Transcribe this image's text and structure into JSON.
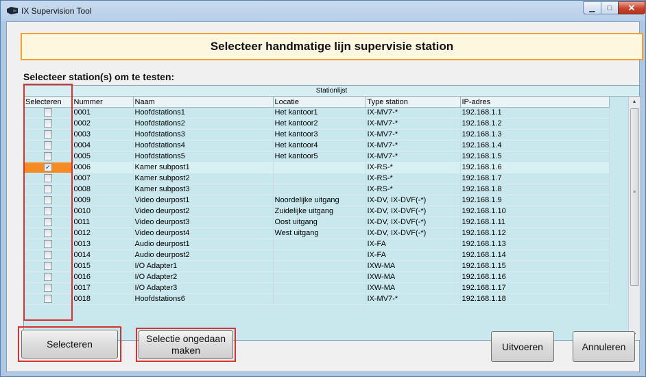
{
  "window": {
    "title": "IX Supervision Tool",
    "icon": "ix-app-icon",
    "controls": [
      "minimize",
      "maximize",
      "close"
    ]
  },
  "header": {
    "title": "Selecteer handmatige lijn supervisie station"
  },
  "instructions": {
    "label": "Selecteer station(s) om te testen:"
  },
  "grid": {
    "caption": "Stationlijst",
    "columns": [
      "Selecteren",
      "Nummer",
      "Naam",
      "Locatie",
      "Type station",
      "IP-adres"
    ],
    "rows": [
      {
        "selected": false,
        "number": "0001",
        "name": "Hoofdstations1",
        "location": "Het kantoor1",
        "type": "IX-MV7-*",
        "ip": "192.168.1.1"
      },
      {
        "selected": false,
        "number": "0002",
        "name": "Hoofdstations2",
        "location": "Het kantoor2",
        "type": "IX-MV7-*",
        "ip": "192.168.1.2"
      },
      {
        "selected": false,
        "number": "0003",
        "name": "Hoofdstations3",
        "location": "Het kantoor3",
        "type": "IX-MV7-*",
        "ip": "192.168.1.3"
      },
      {
        "selected": false,
        "number": "0004",
        "name": "Hoofdstations4",
        "location": "Het kantoor4",
        "type": "IX-MV7-*",
        "ip": "192.168.1.4"
      },
      {
        "selected": false,
        "number": "0005",
        "name": "Hoofdstations5",
        "location": "Het kantoor5",
        "type": "IX-MV7-*",
        "ip": "192.168.1.5"
      },
      {
        "selected": true,
        "number": "0006",
        "name": "Kamer subpost1",
        "location": "",
        "type": "IX-RS-*",
        "ip": "192.168.1.6"
      },
      {
        "selected": false,
        "number": "0007",
        "name": "Kamer subpost2",
        "location": "",
        "type": "IX-RS-*",
        "ip": "192.168.1.7"
      },
      {
        "selected": false,
        "number": "0008",
        "name": "Kamer subpost3",
        "location": "",
        "type": "IX-RS-*",
        "ip": "192.168.1.8"
      },
      {
        "selected": false,
        "number": "0009",
        "name": "Video deurpost1",
        "location": "Noordelijke uitgang",
        "type": "IX-DV, IX-DVF(-*)",
        "ip": "192.168.1.9"
      },
      {
        "selected": false,
        "number": "0010",
        "name": "Video deurpost2",
        "location": "Zuidelijke uitgang",
        "type": "IX-DV, IX-DVF(-*)",
        "ip": "192.168.1.10"
      },
      {
        "selected": false,
        "number": "0011",
        "name": "Video deurpost3",
        "location": "Oost uitgang",
        "type": "IX-DV, IX-DVF(-*)",
        "ip": "192.168.1.11"
      },
      {
        "selected": false,
        "number": "0012",
        "name": "Video deurpost4",
        "location": "West uitgang",
        "type": "IX-DV, IX-DVF(-*)",
        "ip": "192.168.1.12"
      },
      {
        "selected": false,
        "number": "0013",
        "name": "Audio deurpost1",
        "location": "",
        "type": "IX-FA",
        "ip": "192.168.1.13"
      },
      {
        "selected": false,
        "number": "0014",
        "name": "Audio deurpost2",
        "location": "",
        "type": "IX-FA",
        "ip": "192.168.1.14"
      },
      {
        "selected": false,
        "number": "0015",
        "name": "I/O Adapter1",
        "location": "",
        "type": "IXW-MA",
        "ip": "192.168.1.15"
      },
      {
        "selected": false,
        "number": "0016",
        "name": "I/O Adapter2",
        "location": "",
        "type": "IXW-MA",
        "ip": "192.168.1.16"
      },
      {
        "selected": false,
        "number": "0017",
        "name": "I/O Adapter3",
        "location": "",
        "type": "IXW-MA",
        "ip": "192.168.1.17"
      },
      {
        "selected": false,
        "number": "0018",
        "name": "Hoofdstations6",
        "location": "",
        "type": "IX-MV7-*",
        "ip": "192.168.1.18"
      }
    ]
  },
  "buttons": {
    "select": "Selecteren",
    "undo_selection": "Selectie ongedaan maken",
    "execute": "Uitvoeren",
    "cancel": "Annuleren"
  },
  "colors": {
    "highlight_red": "#d9332f",
    "header_border": "#f59f2e",
    "selected_cell": "#f58b25",
    "grid_background": "#c8e8ee"
  }
}
